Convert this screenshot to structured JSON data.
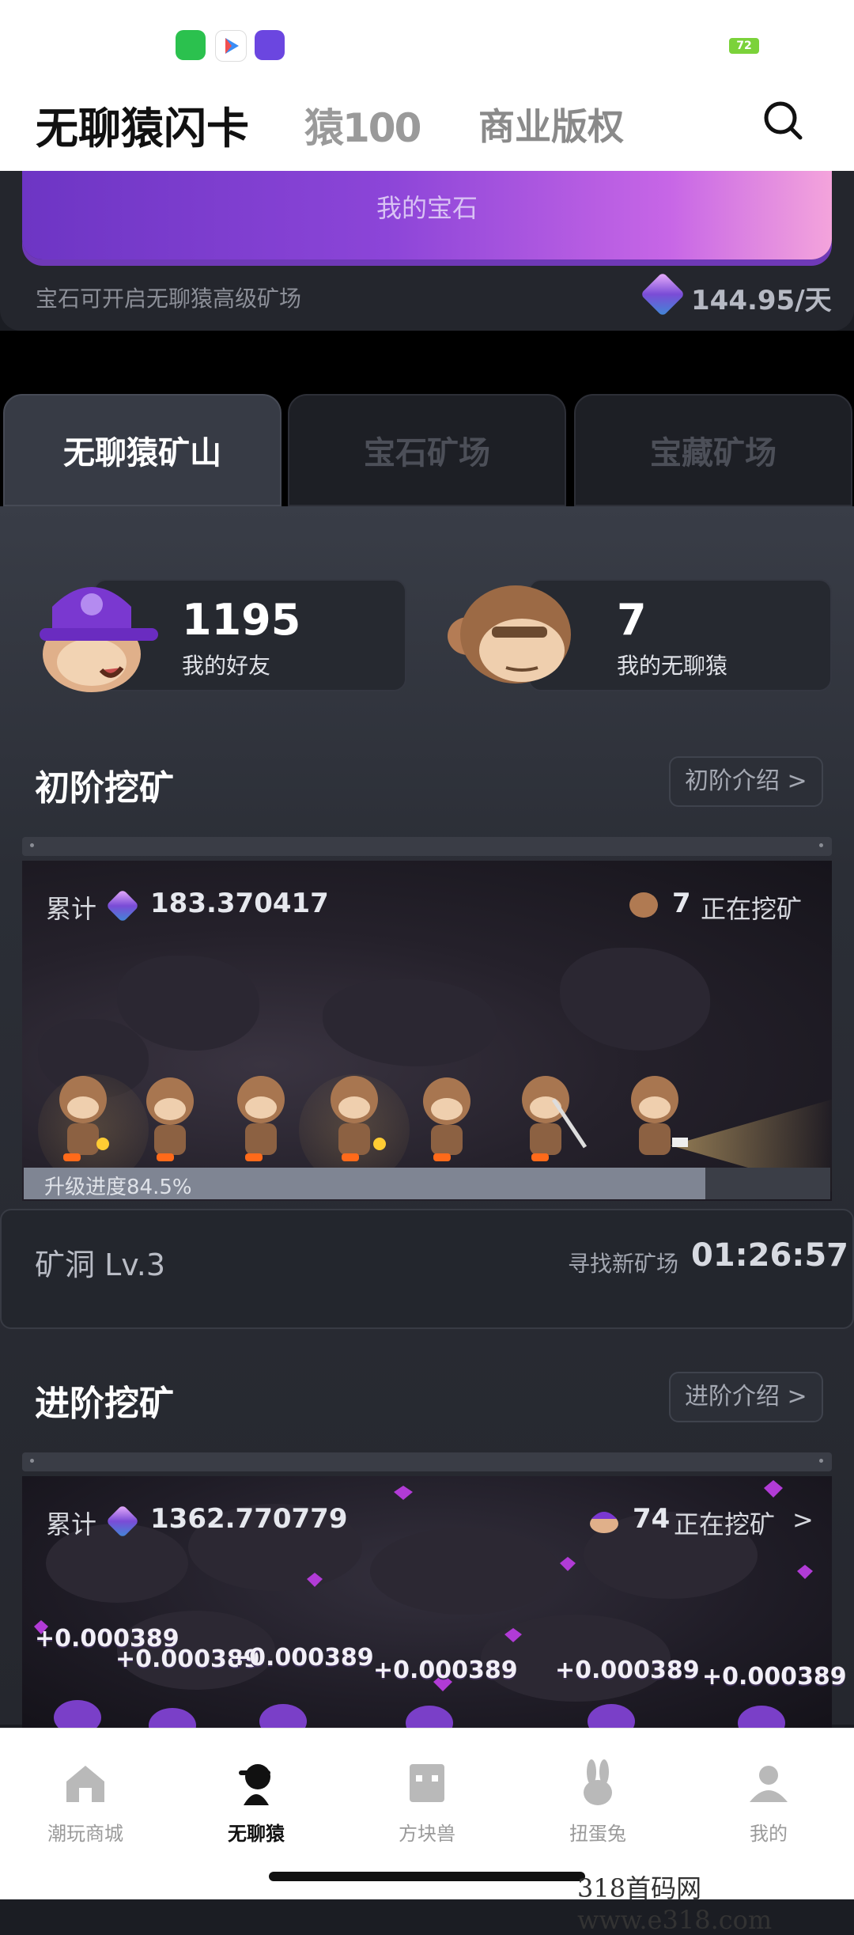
{
  "status_bar": {
    "battery": "72"
  },
  "header": {
    "title": "无聊猿闪卡",
    "logo_text": "猿100",
    "right_text": "商业版权"
  },
  "gem_card": {
    "label": "我的宝石",
    "description": "宝石可开启无聊猿高级矿场",
    "rate": "144.95/天"
  },
  "tabs": [
    {
      "label": "无聊猿矿山",
      "active": true
    },
    {
      "label": "宝石矿场",
      "active": false
    },
    {
      "label": "宝藏矿场",
      "active": false
    }
  ],
  "stats": {
    "friends": {
      "value": "1195",
      "label": "我的好友"
    },
    "apes": {
      "value": "7",
      "label": "我的无聊猿"
    }
  },
  "basic": {
    "title": "初阶挖矿",
    "intro": "初阶介绍",
    "cumulative_label": "累计",
    "cumulative_value": "183.370417",
    "mining_count": "7",
    "mining_text": "正在挖矿",
    "progress_text": "升级进度84.5%",
    "progress": 0.845,
    "cave_level": "矿洞 Lv.3",
    "search_label": "寻找新矿场",
    "timer": "01:26:57"
  },
  "advanced": {
    "title": "进阶挖矿",
    "intro": "进阶介绍",
    "cumulative_label": "累计",
    "cumulative_value": "1362.770779",
    "mining_count": "74",
    "mining_text": "正在挖矿",
    "gains": [
      "+0.000389",
      "+0.000389",
      "+0.000389",
      "+0.000389",
      "+0.000389",
      "+0.000389"
    ]
  },
  "bottom_nav": [
    {
      "label": "潮玩商城",
      "icon": "home-icon",
      "active": false
    },
    {
      "label": "无聊猿",
      "icon": "ape-icon",
      "active": true
    },
    {
      "label": "方块兽",
      "icon": "cube-icon",
      "active": false
    },
    {
      "label": "扭蛋兔",
      "icon": "rabbit-icon",
      "active": false
    },
    {
      "label": "我的",
      "icon": "profile-icon",
      "active": false
    }
  ],
  "watermark": "318首码网 www.e318.com",
  "colors": {
    "gem_gradient_start": "#6d35c4",
    "gem_gradient_end": "#f4a4dc",
    "panel": "#393d47",
    "active_tab": "#373b45"
  }
}
